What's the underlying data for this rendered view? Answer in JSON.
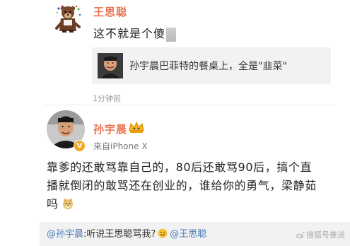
{
  "reply": {
    "author": "王思聪",
    "text": "这不就是个傻",
    "quote_text": "孙宇晨巴菲特的餐桌上，全是\"韭菜\"",
    "time": "1分钟前"
  },
  "post": {
    "author": "孙宇晨",
    "source": "来自iPhone X",
    "verify_icon": "verified-badge-icon",
    "verify_mark": "V",
    "body_lines": [
      "靠爹的还敢骂靠自己的，80后还敢骂90后，搞个直",
      "播就倒闭的敢骂还在创业的，谁给你的勇气，梁静茹",
      "吗"
    ]
  },
  "repost": {
    "mention1": "@孙宇晨",
    "text": ":听说王思聪骂我?",
    "mention2": "@王思聪"
  },
  "watermark": "搜狐号推送",
  "colors": {
    "name": "#eb7350",
    "mention": "#4a7bb8",
    "badge": "#f5a623",
    "panel": "#f2f2f2"
  }
}
